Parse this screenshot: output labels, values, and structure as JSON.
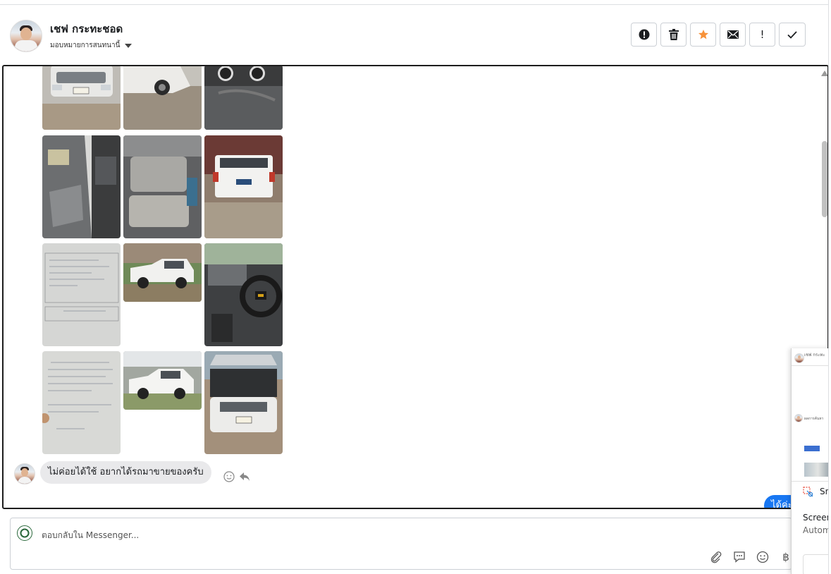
{
  "header": {
    "name": "เชฟ กระทะชอด",
    "assign_label": "มอบหมายการสนทนานี้",
    "actions": [
      "report",
      "delete",
      "star",
      "mail",
      "important",
      "done"
    ],
    "actions_mark_label": "!"
  },
  "colors": {
    "star": "#f7923a",
    "blue": "#1877f2",
    "bubble_bg": "#e9e9eb"
  },
  "conversation": {
    "photos": [
      {
        "desc": "car-front"
      },
      {
        "desc": "car-front-angle"
      },
      {
        "desc": "dashboard"
      },
      {
        "desc": "door-interior"
      },
      {
        "desc": "rear-seat"
      },
      {
        "desc": "truck-rear"
      },
      {
        "desc": "document"
      },
      {
        "desc": "truck-side"
      },
      {
        "desc": "steering-wheel"
      },
      {
        "desc": "document"
      },
      {
        "desc": "truck-side"
      },
      {
        "desc": "engine-bay"
      }
    ],
    "message": "ไม่ค่อยได้ใช้ อยากได้รถมาขายของครับ",
    "sent_preview": "ได้ค่ะ"
  },
  "composer": {
    "placeholder": "ตอบกลับใน Messenger...",
    "currency_symbol": "฿"
  },
  "snip": {
    "name_small": "เชฟ กระทะ",
    "name_small2": "ผลการค้นหา",
    "app_title": "Sni",
    "heading1": "Screen",
    "heading2": "Autom"
  }
}
